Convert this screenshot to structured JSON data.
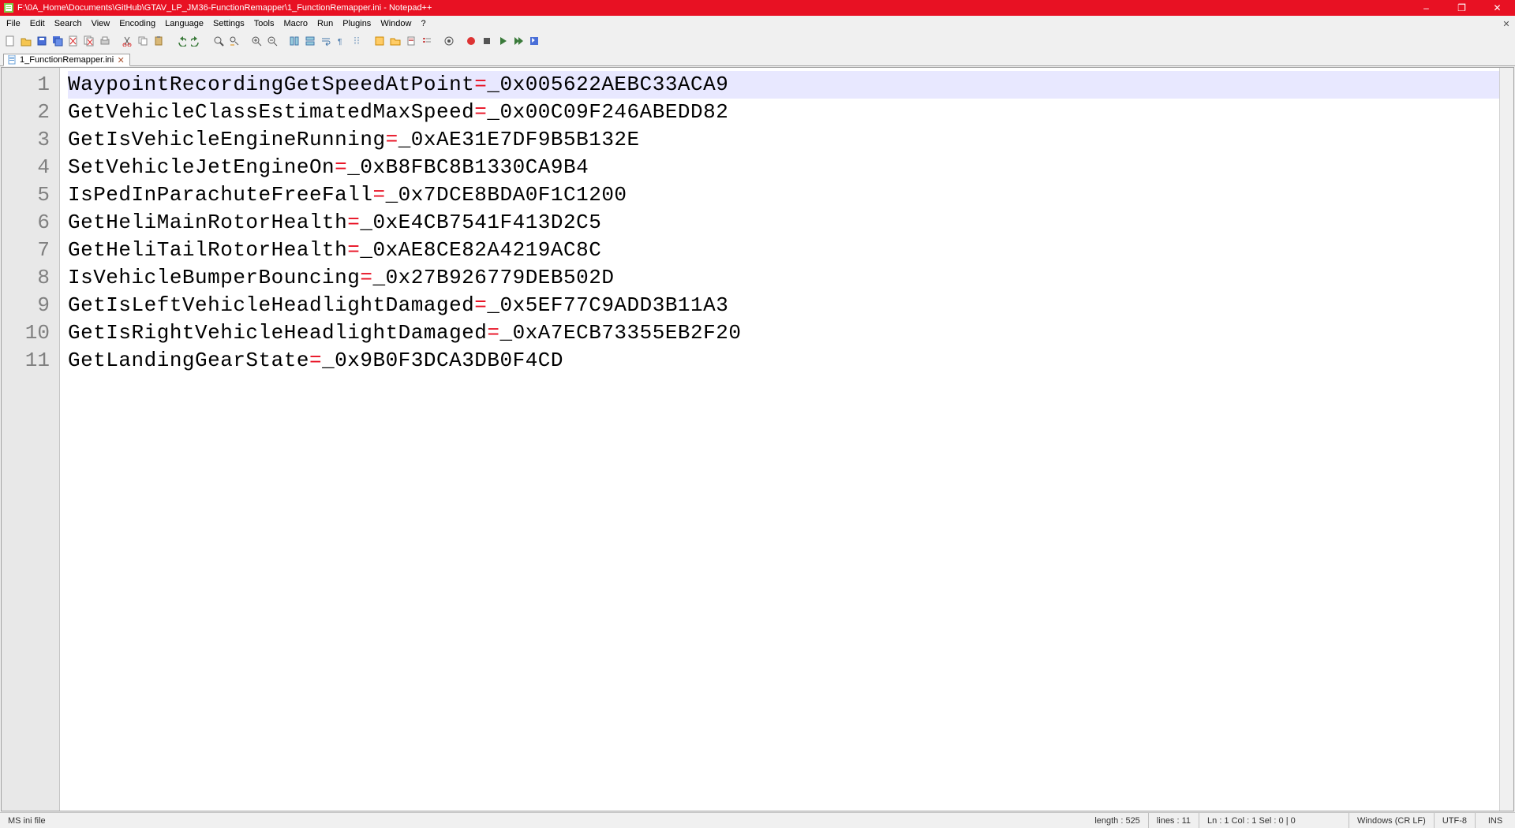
{
  "window": {
    "title": "F:\\0A_Home\\Documents\\GitHub\\GTAV_LP_JM36-FunctionRemapper\\1_FunctionRemapper.ini - Notepad++",
    "minimize": "–",
    "maximize": "❐",
    "close": "✕"
  },
  "menu": [
    "File",
    "Edit",
    "Search",
    "View",
    "Encoding",
    "Language",
    "Settings",
    "Tools",
    "Macro",
    "Run",
    "Plugins",
    "Window",
    "?"
  ],
  "tab": {
    "label": "1_FunctionRemapper.ini",
    "close": "✕"
  },
  "code": [
    {
      "key": "WaypointRecordingGetSpeedAtPoint",
      "val": "_0x005622AEBC33ACA9"
    },
    {
      "key": "GetVehicleClassEstimatedMaxSpeed",
      "val": "_0x00C09F246ABEDD82"
    },
    {
      "key": "GetIsVehicleEngineRunning",
      "val": "_0xAE31E7DF9B5B132E"
    },
    {
      "key": "SetVehicleJetEngineOn",
      "val": "_0xB8FBC8B1330CA9B4"
    },
    {
      "key": "IsPedInParachuteFreeFall",
      "val": "_0x7DCE8BDA0F1C1200"
    },
    {
      "key": "GetHeliMainRotorHealth",
      "val": "_0xE4CB7541F413D2C5"
    },
    {
      "key": "GetHeliTailRotorHealth",
      "val": "_0xAE8CE82A4219AC8C"
    },
    {
      "key": "IsVehicleBumperBouncing",
      "val": "_0x27B926779DEB502D"
    },
    {
      "key": "GetIsLeftVehicleHeadlightDamaged",
      "val": "_0x5EF77C9ADD3B11A3"
    },
    {
      "key": "GetIsRightVehicleHeadlightDamaged",
      "val": "_0xA7ECB73355EB2F20"
    },
    {
      "key": "GetLandingGearState",
      "val": "_0x9B0F3DCA3DB0F4CD"
    }
  ],
  "equals": "=",
  "status": {
    "filetype": "MS ini file",
    "length": "length : 525",
    "lines": "lines : 11",
    "pos": "Ln : 1    Col : 1    Sel : 0 | 0",
    "eol": "Windows (CR LF)",
    "enc": "UTF-8",
    "mode": "INS"
  },
  "toolbar_icons": [
    "new",
    "open",
    "save",
    "save-all",
    "close",
    "close-all",
    "print",
    "sep",
    "cut",
    "copy",
    "paste",
    "sep",
    "undo",
    "redo",
    "sep",
    "find",
    "replace",
    "sep",
    "zoom-in",
    "zoom-out",
    "sep",
    "sync-v",
    "sync-h",
    "wrap",
    "all-chars",
    "indent-guide",
    "sep",
    "lang",
    "folder",
    "doc-map",
    "func-list",
    "sep",
    "monitor",
    "sep",
    "macro-rec",
    "macro-stop",
    "macro-play",
    "macro-play-multi",
    "macro-save"
  ],
  "colors": {
    "accent": "#e81123",
    "gutter": "#e8e8e8",
    "highlight": "#e8e8ff"
  }
}
